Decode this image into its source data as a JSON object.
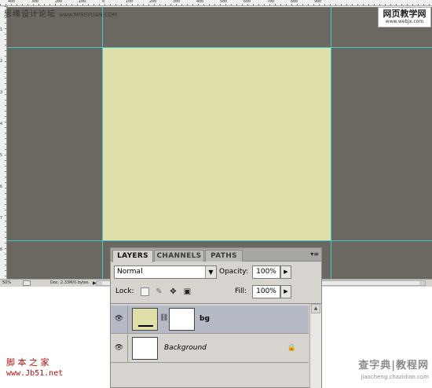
{
  "watermarks": {
    "top_left": "思缘设计论坛",
    "top_left_url": "www.MISSYUAN.COM",
    "top_right_line1": "网页教学网",
    "top_right_line2": "www.webjx.com",
    "bottom_left_line1": "脚 本 之 家",
    "bottom_left_line2": "www.Jb51.net",
    "bottom_right_line1": "查字典|教程网",
    "bottom_right_line2": "jiaocheng.chazidian.com"
  },
  "rulers": {
    "top_labels": [
      "400",
      "300",
      "200",
      "100",
      "0",
      "100",
      "200",
      "300",
      "400",
      "500",
      "600",
      "700",
      "800",
      "900"
    ],
    "left_labels": [
      "1",
      "2",
      "3",
      "4",
      "5",
      "6",
      "7",
      "8"
    ]
  },
  "canvas": {
    "pasteboard_color": "#6b6861",
    "artboard_color": "#dfdfaa",
    "guide_color": "#43c7cf"
  },
  "status_bar": {
    "zoom": "50%",
    "doc_info": "Doc: 2.33M/0 bytes",
    "arrow": "▶"
  },
  "layers_panel": {
    "tabs": [
      {
        "label": "LAYERS",
        "active": true
      },
      {
        "label": "CHANNELS",
        "active": false
      },
      {
        "label": "PATHS",
        "active": false
      }
    ],
    "menu_glyph": "▾≡",
    "blend_mode": "Normal",
    "opacity_label": "Opacity:",
    "opacity_value": "100%",
    "lock_label": "Lock:",
    "fill_label": "Fill:",
    "fill_value": "100%",
    "layers": [
      {
        "name": "bg",
        "selected": true,
        "visible": true,
        "has_mask": true,
        "thumb_color": "#dfdfaa"
      },
      {
        "name": "Background",
        "selected": false,
        "visible": true,
        "locked": true,
        "thumb_color": "#ffffff"
      }
    ]
  }
}
